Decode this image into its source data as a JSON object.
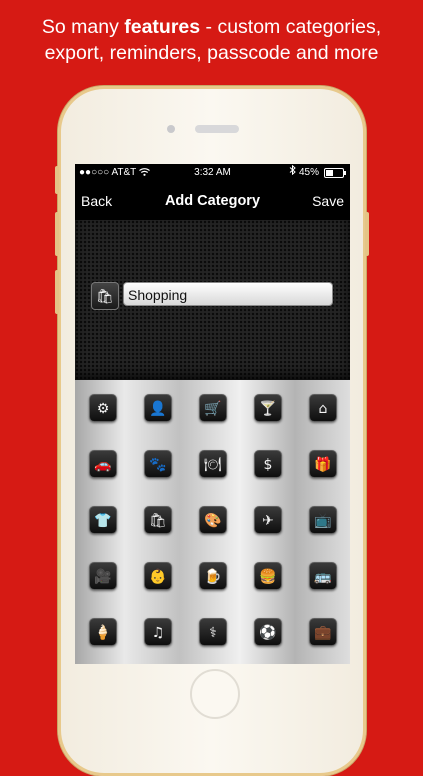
{
  "headline": {
    "line1_before": "So many ",
    "line1_bold": "features",
    "line1_after": " - custom categories,",
    "line2": "export, reminders, passcode and more"
  },
  "status_bar": {
    "signal": "●●○○○",
    "carrier": "AT&T",
    "time": "3:32 AM",
    "battery_percent": "45%",
    "battery_level": 0.45
  },
  "nav": {
    "back_label": "Back",
    "title": "Add Category",
    "save_label": "Save"
  },
  "category_field": {
    "value": "Shopping",
    "icon": "shopping-bag-icon"
  },
  "icons": [
    {
      "name": "gears-icon",
      "glyph": "⚙"
    },
    {
      "name": "person-icon",
      "glyph": "👤"
    },
    {
      "name": "shopping-cart-icon",
      "glyph": "🛒"
    },
    {
      "name": "cocktail-icon",
      "glyph": "🍸"
    },
    {
      "name": "home-icon",
      "glyph": "⌂"
    },
    {
      "name": "car-icon",
      "glyph": "🚗"
    },
    {
      "name": "paw-icon",
      "glyph": "🐾"
    },
    {
      "name": "dining-icon",
      "glyph": "🍽"
    },
    {
      "name": "money-icon",
      "glyph": "$"
    },
    {
      "name": "gift-icon",
      "glyph": "🎁"
    },
    {
      "name": "shirt-icon",
      "glyph": "👕"
    },
    {
      "name": "shopping-bag-icon",
      "glyph": "🛍"
    },
    {
      "name": "palette-icon",
      "glyph": "🎨"
    },
    {
      "name": "airplane-icon",
      "glyph": "✈"
    },
    {
      "name": "tv-icon",
      "glyph": "📺"
    },
    {
      "name": "film-camera-icon",
      "glyph": "🎥"
    },
    {
      "name": "baby-icon",
      "glyph": "👶"
    },
    {
      "name": "beer-icon",
      "glyph": "🍺"
    },
    {
      "name": "burger-icon",
      "glyph": "🍔"
    },
    {
      "name": "bus-icon",
      "glyph": "🚌"
    },
    {
      "name": "ice-cream-icon",
      "glyph": "🍦"
    },
    {
      "name": "music-note-icon",
      "glyph": "♫"
    },
    {
      "name": "medical-icon",
      "glyph": "⚕"
    },
    {
      "name": "soccer-ball-icon",
      "glyph": "⚽"
    },
    {
      "name": "briefcase-icon",
      "glyph": "💼"
    }
  ]
}
